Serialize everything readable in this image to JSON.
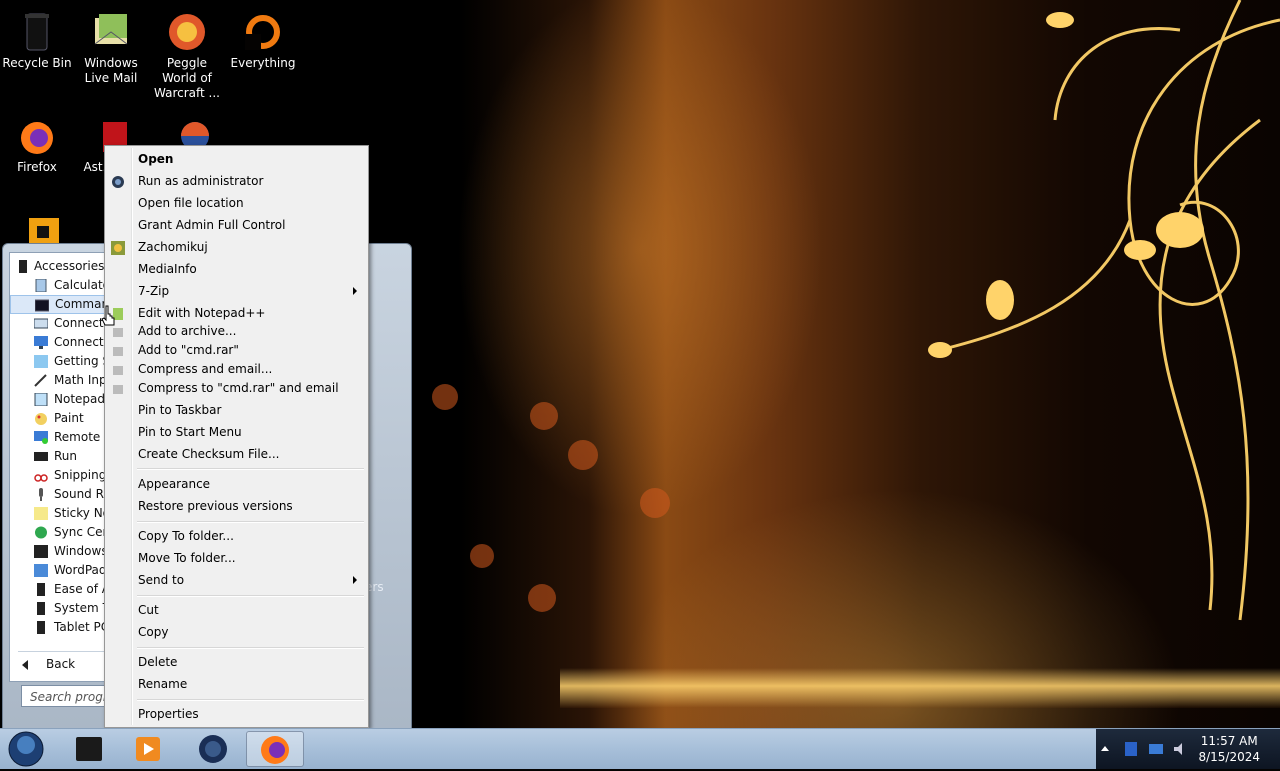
{
  "desktop": {
    "icons": [
      {
        "label": "Recycle Bin"
      },
      {
        "label": "Windows Live Mail"
      },
      {
        "label": "Peggle World of Warcraft ..."
      },
      {
        "label": "Everything"
      },
      {
        "label": "Firefox"
      },
      {
        "label": "Ast... D..."
      }
    ]
  },
  "start_menu": {
    "folder": "Accessories",
    "items": [
      {
        "label": "Calculato"
      },
      {
        "label": "Comman"
      },
      {
        "label": "Connect"
      },
      {
        "label": "Connect t"
      },
      {
        "label": "Getting St"
      },
      {
        "label": "Math Inpu"
      },
      {
        "label": "Notepad"
      },
      {
        "label": "Paint"
      },
      {
        "label": "Remote D"
      },
      {
        "label": "Run"
      },
      {
        "label": "Snipping T"
      },
      {
        "label": "Sound Re"
      },
      {
        "label": "Sticky No"
      },
      {
        "label": "Sync Cent"
      },
      {
        "label": "Windows"
      },
      {
        "label": "WordPad"
      },
      {
        "label": "Ease of Ac"
      },
      {
        "label": "System To"
      },
      {
        "label": "Tablet PC"
      }
    ],
    "back_label": "Back",
    "search_placeholder": "Search progra",
    "right_partial": "ers"
  },
  "context_menu": {
    "items": [
      {
        "label": "Open"
      },
      {
        "label": "Run as administrator"
      },
      {
        "label": "Open file location"
      },
      {
        "label": "Grant Admin Full Control"
      },
      {
        "label": "Zachomikuj"
      },
      {
        "label": "MediaInfo"
      },
      {
        "label": "7-Zip"
      },
      {
        "label": "Edit with Notepad++"
      },
      {
        "label": "Add to archive..."
      },
      {
        "label": "Add to \"cmd.rar\""
      },
      {
        "label": "Compress and email..."
      },
      {
        "label": "Compress to \"cmd.rar\" and email"
      },
      {
        "label": "Pin to Taskbar"
      },
      {
        "label": "Pin to Start Menu"
      },
      {
        "label": "Create Checksum File..."
      },
      {
        "label": "Appearance"
      },
      {
        "label": "Restore previous versions"
      },
      {
        "label": "Copy To folder..."
      },
      {
        "label": "Move To folder..."
      },
      {
        "label": "Send to"
      },
      {
        "label": "Cut"
      },
      {
        "label": "Copy"
      },
      {
        "label": "Delete"
      },
      {
        "label": "Rename"
      },
      {
        "label": "Properties"
      }
    ]
  },
  "taskbar": {
    "time": "11:57 AM",
    "date": "8/15/2024"
  },
  "colors": {
    "menu_bg": "#f0f0f0",
    "taskbar": "#a7bfd9",
    "selection": "#dbe8f8"
  }
}
